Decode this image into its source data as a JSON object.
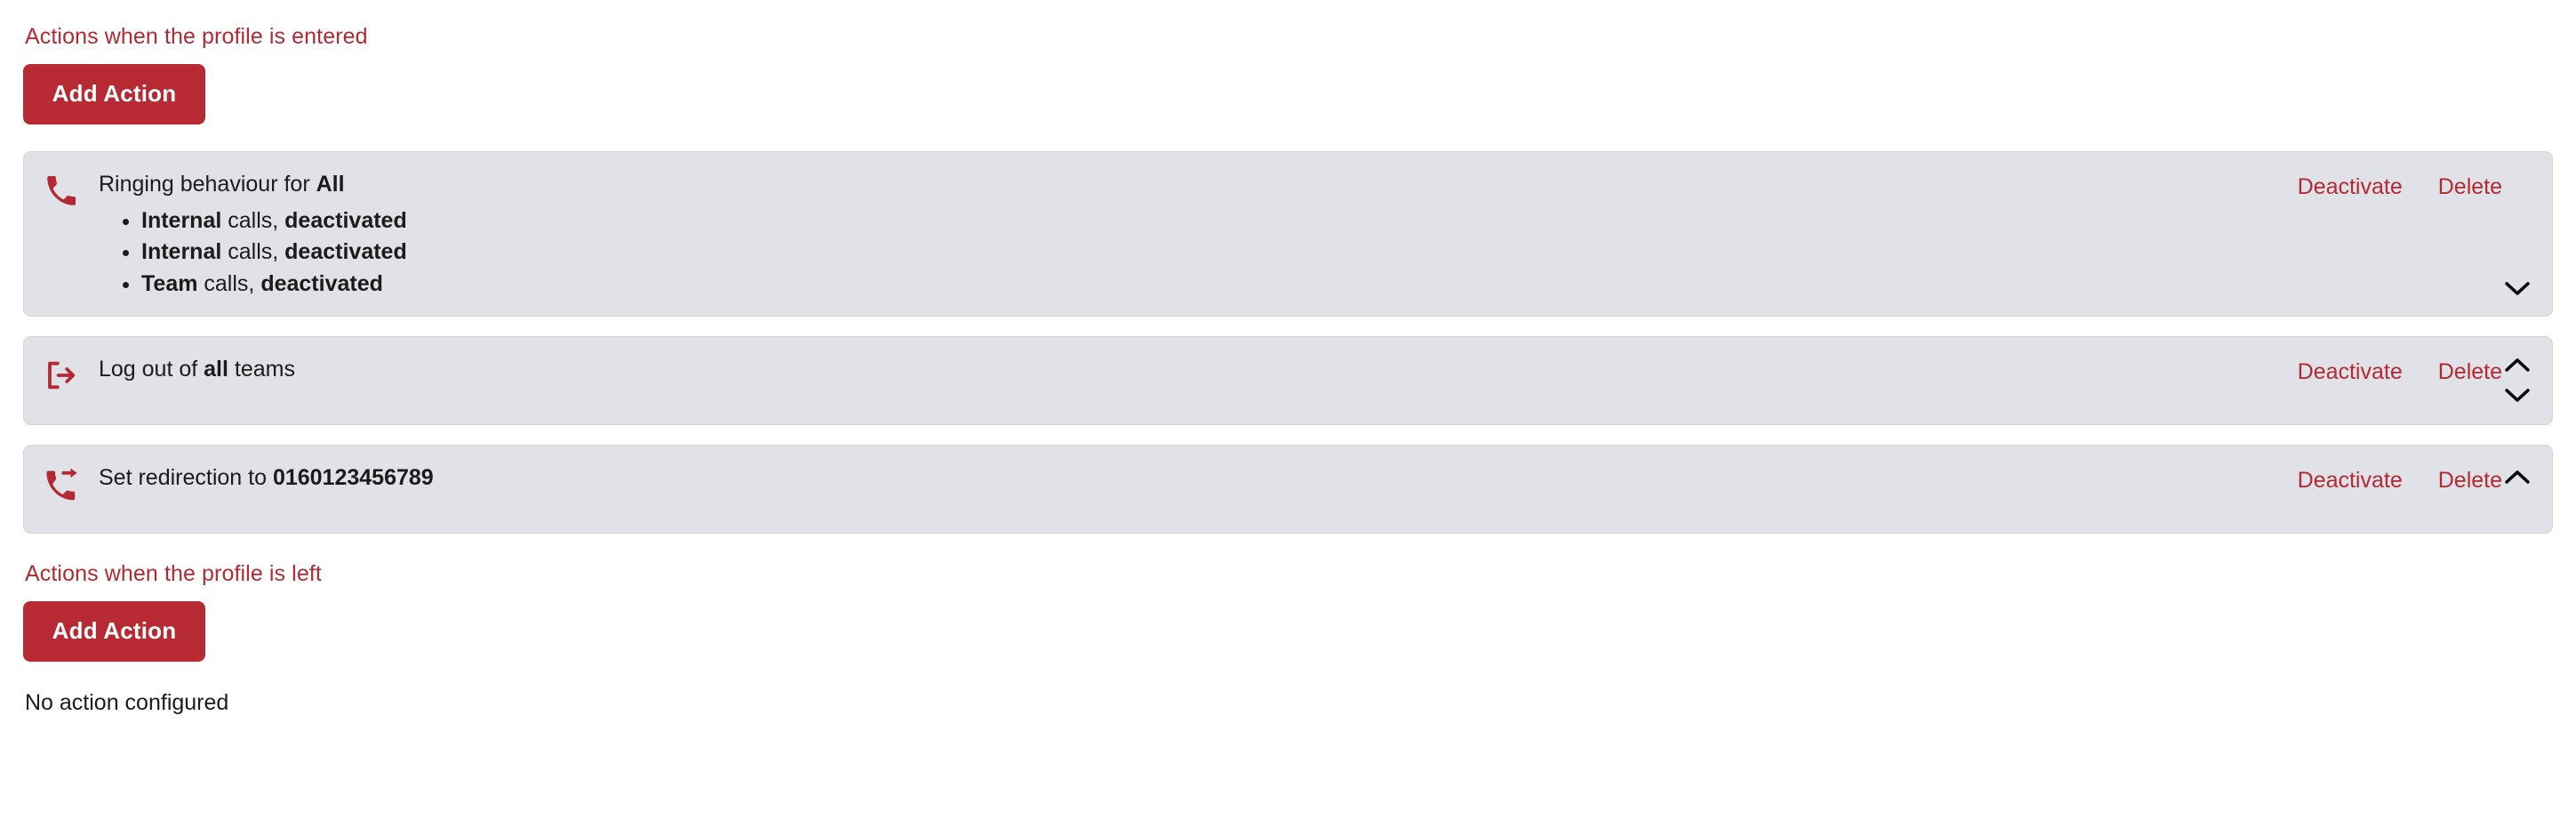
{
  "sections": {
    "entered": {
      "heading": "Actions when the profile is entered",
      "add_button_label": "Add Action"
    },
    "left": {
      "heading": "Actions when the profile is left",
      "add_button_label": "Add Action",
      "empty_text": "No action configured"
    }
  },
  "labels": {
    "deactivate": "Deactivate",
    "delete": "Delete"
  },
  "colors": {
    "accent_red": "#b42a34",
    "button_red": "#b72a33",
    "card_background": "#e0e2e7",
    "card_border": "#d2d4d9",
    "text": "#1b1b1b"
  },
  "actions": [
    {
      "icon": "phone-icon",
      "title_prefix": "Ringing behaviour for ",
      "title_strong": "All",
      "title_suffix": "",
      "sublist": [
        {
          "strong_1": "Internal",
          "middle": " calls, ",
          "strong_2": "deactivated"
        },
        {
          "strong_1": "Internal",
          "middle": " calls, ",
          "strong_2": "deactivated"
        },
        {
          "strong_1": "Team",
          "middle": " calls, ",
          "strong_2": "deactivated"
        }
      ],
      "deactivate_label": "Deactivate",
      "delete_label": "Delete",
      "move_up": false,
      "move_down": true
    },
    {
      "icon": "logout-icon",
      "title_prefix": "Log out of ",
      "title_strong": "all",
      "title_suffix": " teams",
      "sublist": [],
      "deactivate_label": "Deactivate",
      "delete_label": "Delete",
      "move_up": true,
      "move_down": true
    },
    {
      "icon": "phone-forward-icon",
      "title_prefix": "Set redirection to ",
      "title_strong": "0160123456789",
      "title_suffix": "",
      "sublist": [],
      "deactivate_label": "Deactivate",
      "delete_label": "Delete",
      "move_up": true,
      "move_down": false
    }
  ]
}
